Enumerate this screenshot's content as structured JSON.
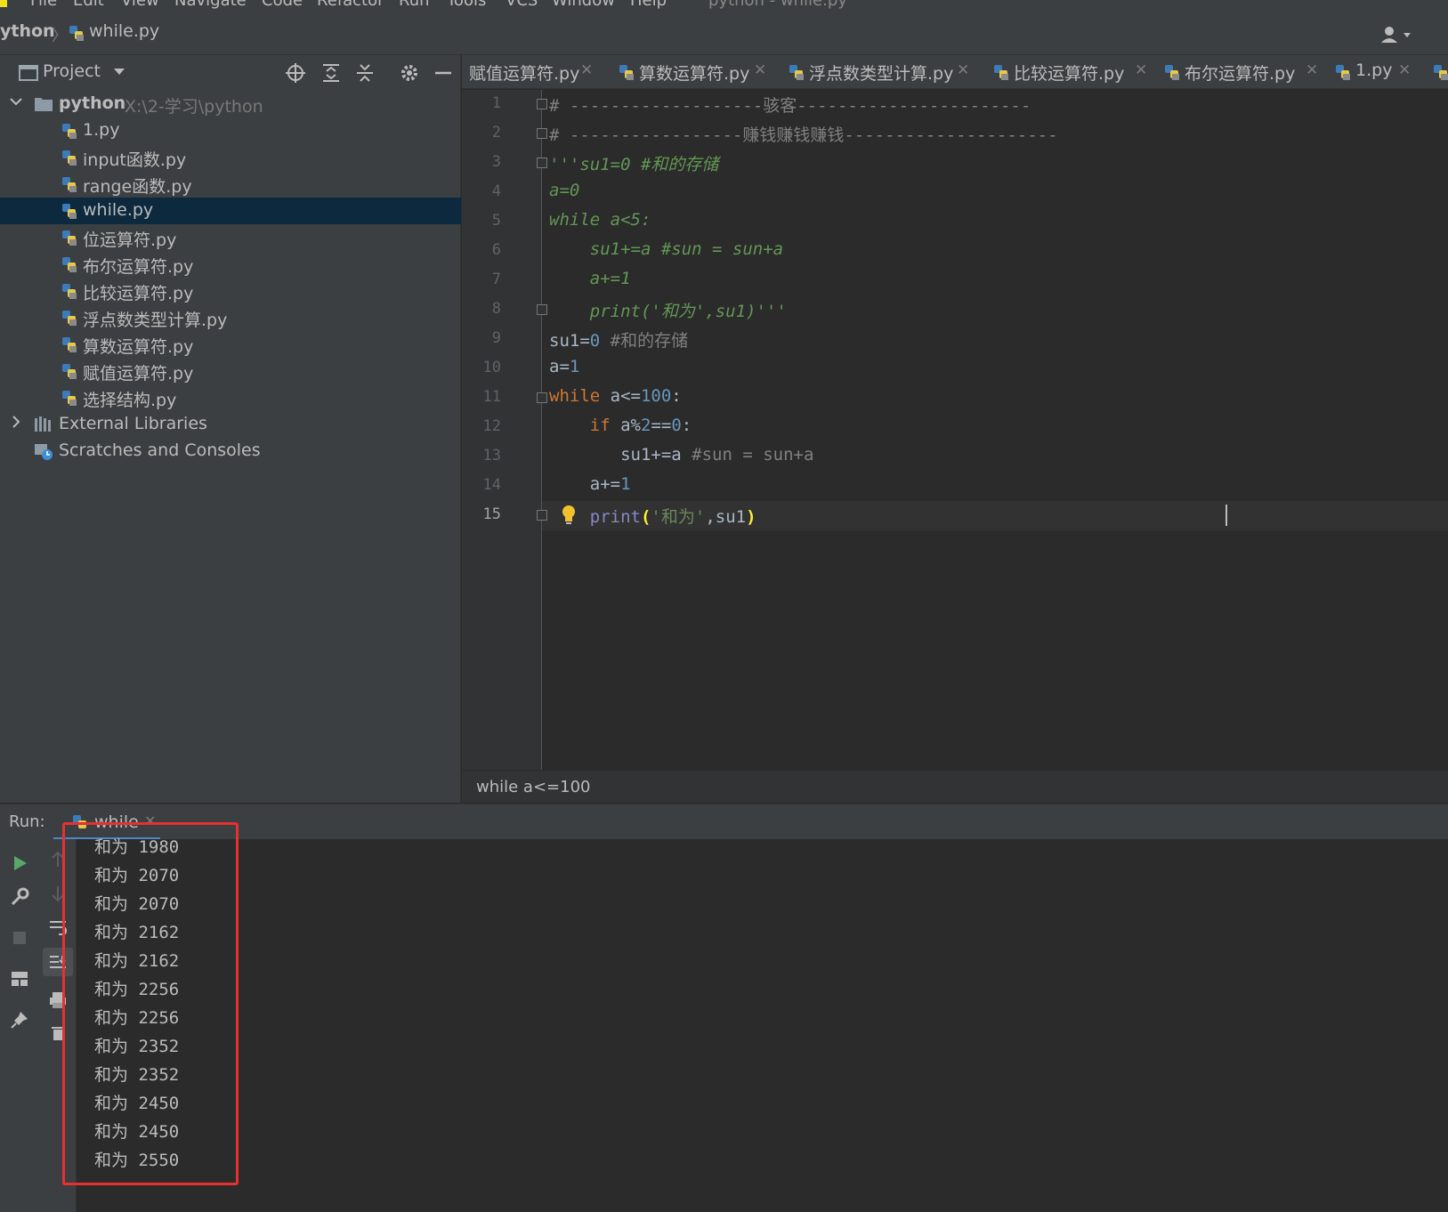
{
  "menubar": {
    "items": [
      "File",
      "Edit",
      "View",
      "Navigate",
      "Code",
      "Refactor",
      "Run",
      "Tools",
      "VCS",
      "Window",
      "Help",
      "python - while.py"
    ]
  },
  "navbar": {
    "project": "ython",
    "file": "while.py"
  },
  "project_panel": {
    "title": "Project",
    "root": {
      "name": "python",
      "path": "X:\\2-学习\\python"
    },
    "files": [
      "1.py",
      "input函数.py",
      "range函数.py",
      "while.py",
      "位运算符.py",
      "布尔运算符.py",
      "比较运算符.py",
      "浮点数类型计算.py",
      "算数运算符.py",
      "赋值运算符.py",
      "选择结构.py"
    ],
    "selected_file": "while.py",
    "external_libraries": "External Libraries",
    "scratches": "Scratches and Consoles"
  },
  "tabs": [
    "赋值运算符.py",
    "算数运算符.py",
    "浮点数类型计算.py",
    "比较运算符.py",
    "布尔运算符.py",
    "1.py"
  ],
  "editor": {
    "line_numbers": [
      "1",
      "2",
      "3",
      "4",
      "5",
      "6",
      "7",
      "8",
      "9",
      "10",
      "11",
      "12",
      "13",
      "14",
      "15"
    ],
    "current_line": "15",
    "lines": {
      "l1": "# -------------------骇客-----------------------",
      "l2": "# -----------------赚钱赚钱赚钱---------------------",
      "l3": "'''su1=0 #和的存储",
      "l4": "a=0",
      "l5": "while a<5:",
      "l6": "    su1+=a #sun = sun+a",
      "l7": "    a+=1",
      "l8": "    print('和为',su1)'''",
      "l9_code": "su1=",
      "l9_num": "0",
      "l9_comment": " #和的存储",
      "l10_code": "a=",
      "l10_num": "1",
      "l11_kw": "while",
      "l11_code": " a<=",
      "l11_num": "100",
      "l11_end": ":",
      "l12_indent": "    ",
      "l12_kw": "if",
      "l12_code": " a%",
      "l12_num1": "2",
      "l12_op": "==",
      "l12_num2": "0",
      "l12_end": ":",
      "l13_code": "       su1+=a ",
      "l13_comment": "#sun = sun+a",
      "l14_code": "    a+=",
      "l14_num": "1",
      "l15_indent": "    ",
      "l15_fn": "print",
      "l15_open": "(",
      "l15_str": "'和为'",
      "l15_args": ",su1",
      "l15_close": ")"
    }
  },
  "status_breadcrumb": "while a<=100",
  "run_panel": {
    "label": "Run:",
    "tab": "while",
    "output": [
      "和为 1980",
      "和为 2070",
      "和为 2070",
      "和为 2162",
      "和为 2162",
      "和为 2256",
      "和为 2256",
      "和为 2352",
      "和为 2352",
      "和为 2450",
      "和为 2450",
      "和为 2550"
    ]
  },
  "colors": {
    "highlight_box": "#ea2f2f",
    "selection": "#0d293e",
    "keyword": "#cc7832",
    "number": "#6897bb"
  }
}
